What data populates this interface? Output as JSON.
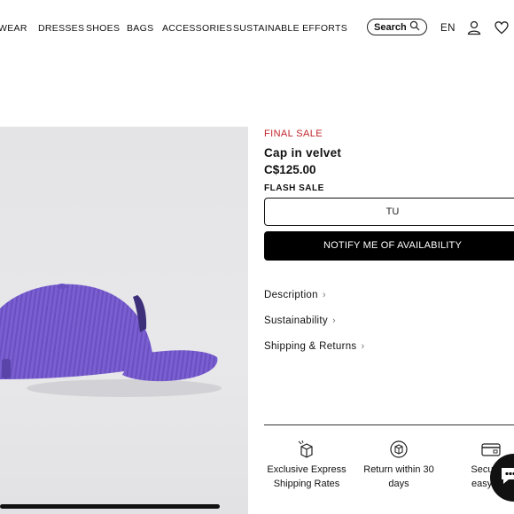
{
  "nav": {
    "items": [
      "WEAR",
      "DRESSES",
      "SHOES",
      "BAGS",
      "ACCESSORIES",
      "SUSTAINABLE EFFORTS"
    ],
    "search_label": "Search",
    "lang": "EN"
  },
  "product": {
    "badge": "FINAL SALE",
    "title": "Cap in velvet",
    "price": "C$125.00",
    "flash": "FLASH SALE",
    "size": "TU",
    "notify": "NOTIFY ME OF AVAILABILITY"
  },
  "accordions": [
    "Description",
    "Sustainability",
    "Shipping & Returns"
  ],
  "features": [
    {
      "line1": "Exclusive Express",
      "line2": "Shipping Rates",
      "icon": "box-icon"
    },
    {
      "line1": "Return within 30",
      "line2": "days",
      "icon": "return-icon"
    },
    {
      "line1": "Secure &",
      "line2": "easy pay",
      "icon": "card-icon"
    }
  ],
  "colors": {
    "accent_red": "#c0252b",
    "cap_purple": "#7a5fd0",
    "black": "#000000"
  }
}
